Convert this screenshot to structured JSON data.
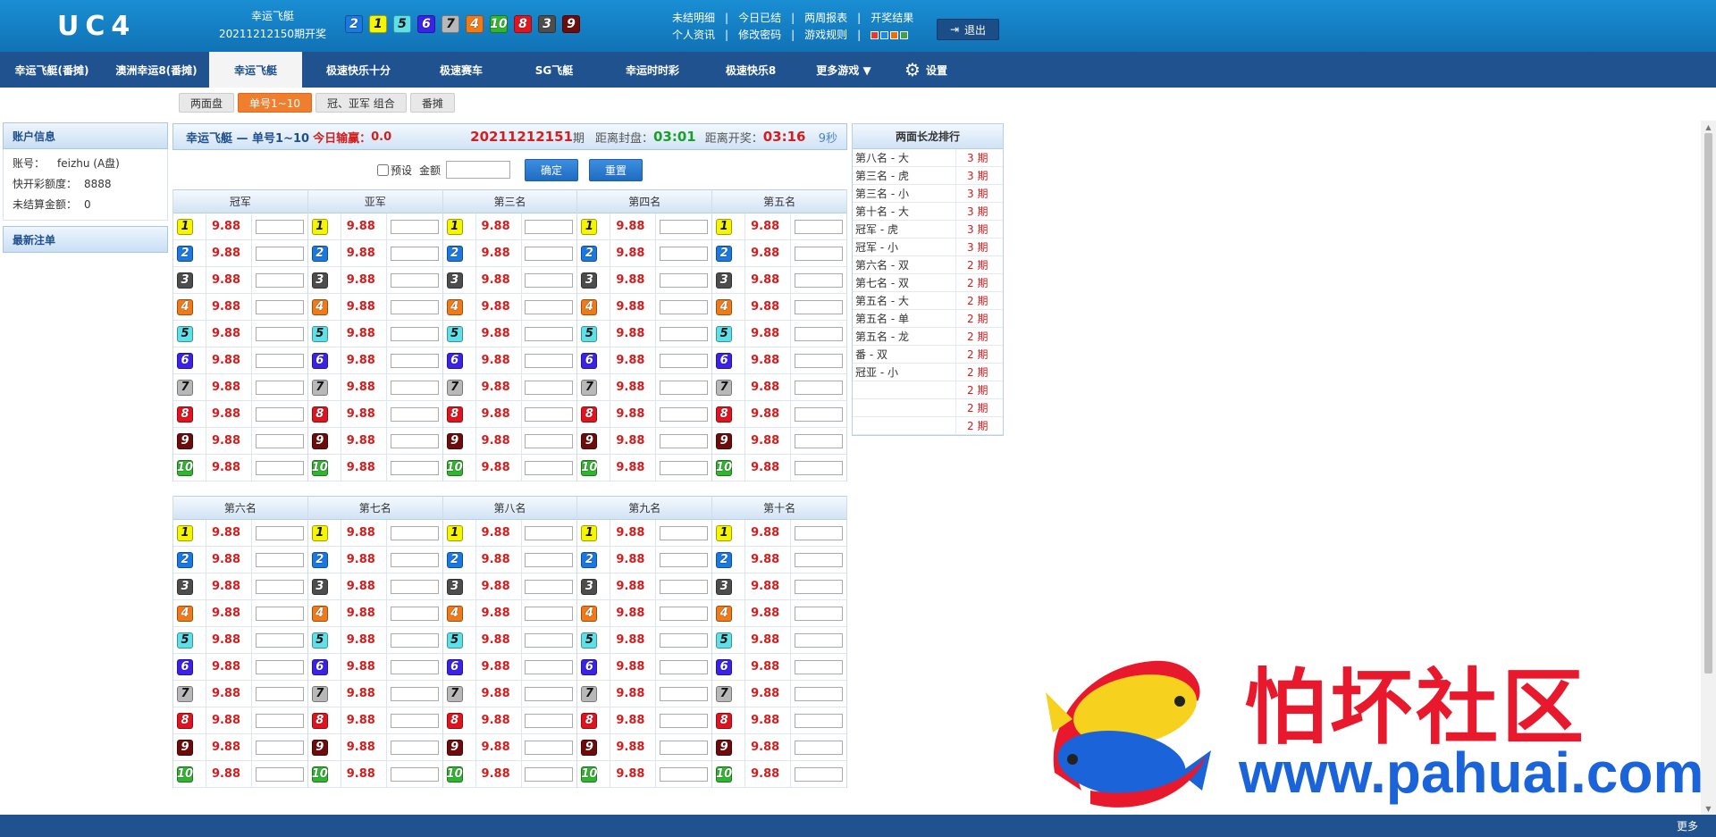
{
  "header": {
    "logo": "UC4",
    "game_name": "幸运飞艇",
    "draw_issue": "20211212150期开奖",
    "balls": [
      2,
      1,
      5,
      6,
      7,
      4,
      10,
      8,
      3,
      9
    ],
    "links_row1": [
      "未结明细",
      "今日已结",
      "两周报表",
      "开奖结果"
    ],
    "links_row2": [
      "个人资讯",
      "修改密码",
      "游戏规则"
    ],
    "theme_colors": [
      "#e53935",
      "#1e88e5",
      "#ef6c00",
      "#43a047"
    ],
    "logout": "退出"
  },
  "nav": {
    "items": [
      "幸运飞艇(番摊)",
      "澳洲幸运8(番摊)",
      "幸运飞艇",
      "极速快乐十分",
      "极速赛车",
      "SG飞艇",
      "幸运时时彩",
      "极速快乐8",
      "更多游戏 ▼"
    ],
    "settings": "设置",
    "active_index": 2
  },
  "subnav": {
    "tabs": [
      "两面盘",
      "单号1~10",
      "冠、亚军 组合",
      "番摊"
    ],
    "active_index": 1
  },
  "account": {
    "title": "账户信息",
    "rows": [
      {
        "label": "账号：",
        "value": "feizhu (A盘)"
      },
      {
        "label": "快开彩额度：",
        "value": "8888"
      },
      {
        "label": "未结算金额：",
        "value": "0"
      }
    ],
    "latest_title": "最新注单"
  },
  "main": {
    "game": "幸运飞艇 — 单号1~10",
    "today_label": "今日输赢：",
    "today_value": "0.0",
    "issue": "20211212151",
    "issue_suffix": "期",
    "close_label": "距离封盘：",
    "close_time": "03:01",
    "open_label": "距离开奖：",
    "open_time": "03:16",
    "refresh": "9秒",
    "preset_label": "预设",
    "amount_label": "金额",
    "confirm": "确定",
    "reset": "重置"
  },
  "grid1": {
    "columns": [
      "冠军",
      "亚军",
      "第三名",
      "第四名",
      "第五名"
    ]
  },
  "grid2": {
    "columns": [
      "第六名",
      "第七名",
      "第八名",
      "第九名",
      "第十名"
    ]
  },
  "odds": "9.88",
  "numbers": [
    1,
    2,
    3,
    4,
    5,
    6,
    7,
    8,
    9,
    10
  ],
  "ranking": {
    "title": "两面长龙排行",
    "rows": [
      {
        "name": "第八名 - 大",
        "value": "3 期"
      },
      {
        "name": "第三名 - 虎",
        "value": "3 期"
      },
      {
        "name": "第三名 - 小",
        "value": "3 期"
      },
      {
        "name": "第十名 - 大",
        "value": "3 期"
      },
      {
        "name": "冠军 - 虎",
        "value": "3 期"
      },
      {
        "name": "冠军 - 小",
        "value": "3 期"
      },
      {
        "name": "第六名 - 双",
        "value": "2 期"
      },
      {
        "name": "第七名 - 双",
        "value": "2 期"
      },
      {
        "name": "第五名 - 大",
        "value": "2 期"
      },
      {
        "name": "第五名 - 单",
        "value": "2 期"
      },
      {
        "name": "第五名 - 龙",
        "value": "2 期"
      },
      {
        "name": "番 - 双",
        "value": "2 期"
      },
      {
        "name": "冠亚 - 小",
        "value": "2 期"
      },
      {
        "name": "",
        "value": "2 期"
      },
      {
        "name": "",
        "value": "2 期"
      },
      {
        "name": "",
        "value": "2 期"
      }
    ]
  },
  "footer": {
    "more": "更多"
  },
  "watermark": {
    "text": "怕坏社区",
    "url": "www.pahuai.com"
  }
}
